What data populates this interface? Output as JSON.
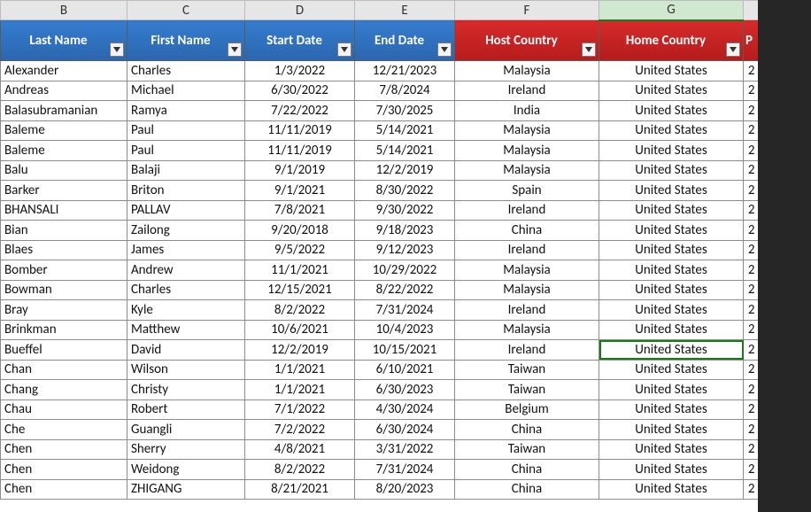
{
  "columns": {
    "letters": [
      "B",
      "C",
      "D",
      "E",
      "F",
      "G",
      ""
    ],
    "selected_letter_index": 5,
    "headers": [
      {
        "label": "Last Name",
        "style": "blue",
        "filter": true
      },
      {
        "label": "First Name",
        "style": "blue",
        "filter": true
      },
      {
        "label": "Start Date",
        "style": "blue",
        "filter": true
      },
      {
        "label": "End Date",
        "style": "blue",
        "filter": true
      },
      {
        "label": "Host Country",
        "style": "red",
        "filter": true
      },
      {
        "label": "Home Country",
        "style": "red",
        "filter": true
      },
      {
        "label": "P",
        "style": "red",
        "filter": false
      }
    ]
  },
  "selected_cell": {
    "row_index": 15,
    "col_index": 5
  },
  "chart_data": {
    "type": "table",
    "columns": [
      "Last Name",
      "First Name",
      "Start Date",
      "End Date",
      "Host Country",
      "Home Country",
      "P"
    ],
    "rows": [
      [
        "Alexander",
        "Charles",
        "1/3/2022",
        "12/21/2023",
        "Malaysia",
        "United States",
        "2"
      ],
      [
        "Andreas",
        "Michael",
        "6/30/2022",
        "7/8/2024",
        "Ireland",
        "United States",
        "2"
      ],
      [
        "Balasubramanian",
        "Ramya",
        "7/22/2022",
        "7/30/2025",
        "India",
        "United States",
        "2"
      ],
      [
        "Baleme",
        "Paul",
        "11/11/2019",
        "5/14/2021",
        "Malaysia",
        "United States",
        "2"
      ],
      [
        "Baleme",
        "Paul",
        "11/11/2019",
        "5/14/2021",
        "Malaysia",
        "United States",
        "2"
      ],
      [
        "Balu",
        "Balaji",
        "9/1/2019",
        "12/2/2019",
        "Malaysia",
        "United States",
        "2"
      ],
      [
        "Barker",
        "Briton",
        "9/1/2021",
        "8/30/2022",
        "Spain",
        "United States",
        "2"
      ],
      [
        "BHANSALI",
        "PALLAV",
        "7/8/2021",
        "9/30/2022",
        "Ireland",
        "United States",
        "2"
      ],
      [
        "Bian",
        "Zailong",
        "9/20/2018",
        "9/18/2023",
        "China",
        "United States",
        "2"
      ],
      [
        "Blaes",
        "James",
        "9/5/2022",
        "9/12/2023",
        "Ireland",
        "United States",
        "2"
      ],
      [
        "Bomber",
        "Andrew",
        "11/1/2021",
        "10/29/2022",
        "Malaysia",
        "United States",
        "2"
      ],
      [
        "Bowman",
        "Charles",
        "12/15/2021",
        "8/22/2022",
        "Malaysia",
        "United States",
        "2"
      ],
      [
        "Bray",
        "Kyle",
        "8/2/2022",
        "7/31/2024",
        "Ireland",
        "United States",
        "2"
      ],
      [
        "Brinkman",
        "Matthew",
        "10/6/2021",
        "10/4/2023",
        "Malaysia",
        "United States",
        "2"
      ],
      [
        "Bueffel",
        "David",
        "12/2/2019",
        "10/15/2021",
        "Ireland",
        "United States",
        "2"
      ],
      [
        "Chan",
        "Wilson",
        "1/1/2021",
        "6/10/2021",
        "Taiwan",
        "United States",
        "2"
      ],
      [
        "Chang",
        "Christy",
        "1/1/2021",
        "6/30/2023",
        "Taiwan",
        "United States",
        "2"
      ],
      [
        "Chau",
        "Robert",
        "7/1/2022",
        "4/30/2024",
        "Belgium",
        "United States",
        "2"
      ],
      [
        "Che",
        "Guangli",
        "7/2/2022",
        "6/30/2024",
        "China",
        "United States",
        "2"
      ],
      [
        "Chen",
        "Sherry",
        "4/8/2021",
        "3/31/2022",
        "Taiwan",
        "United States",
        "2"
      ],
      [
        "Chen",
        "Weidong",
        "8/2/2022",
        "7/31/2024",
        "China",
        "United States",
        "2"
      ],
      [
        "Chen",
        "ZHIGANG",
        "8/21/2021",
        "8/20/2023",
        "China",
        "United States",
        "2"
      ]
    ]
  }
}
